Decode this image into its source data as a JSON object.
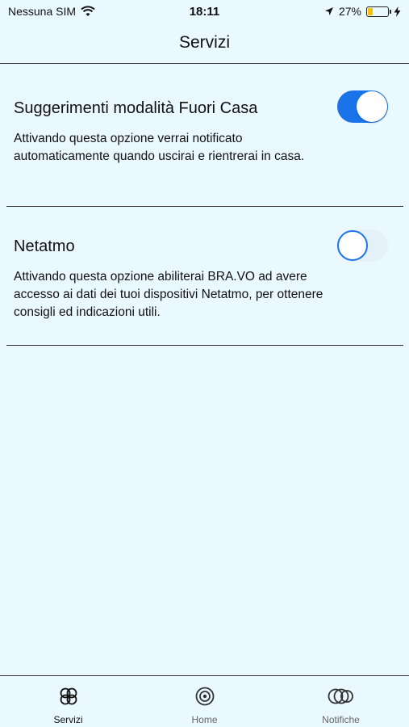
{
  "status_bar": {
    "carrier": "Nessuna SIM",
    "time": "18:11",
    "battery_percent": "27%",
    "battery_level": 0.27,
    "battery_color": "#f2c200"
  },
  "header": {
    "title": "Servizi"
  },
  "settings": [
    {
      "title": "Suggerimenti modalità Fuori Casa",
      "description": "Attivando questa opzione verrai notificato automaticamente quando uscirai e rientrerai in casa.",
      "enabled": true
    },
    {
      "title": "Netatmo",
      "description": "Attivando questa opzione abiliterai BRA.VO ad avere accesso ai dati dei tuoi dispositivi Netatmo, per ottenere consigli ed indicazioni utili.",
      "enabled": false
    }
  ],
  "tabs": [
    {
      "label": "Servizi",
      "icon": "services-icon",
      "active": true
    },
    {
      "label": "Home",
      "icon": "home-target-icon",
      "active": false
    },
    {
      "label": "Notifiche",
      "icon": "notifications-icon",
      "active": false
    }
  ],
  "colors": {
    "accent": "#1a73e8",
    "background": "#eaf8ff"
  }
}
